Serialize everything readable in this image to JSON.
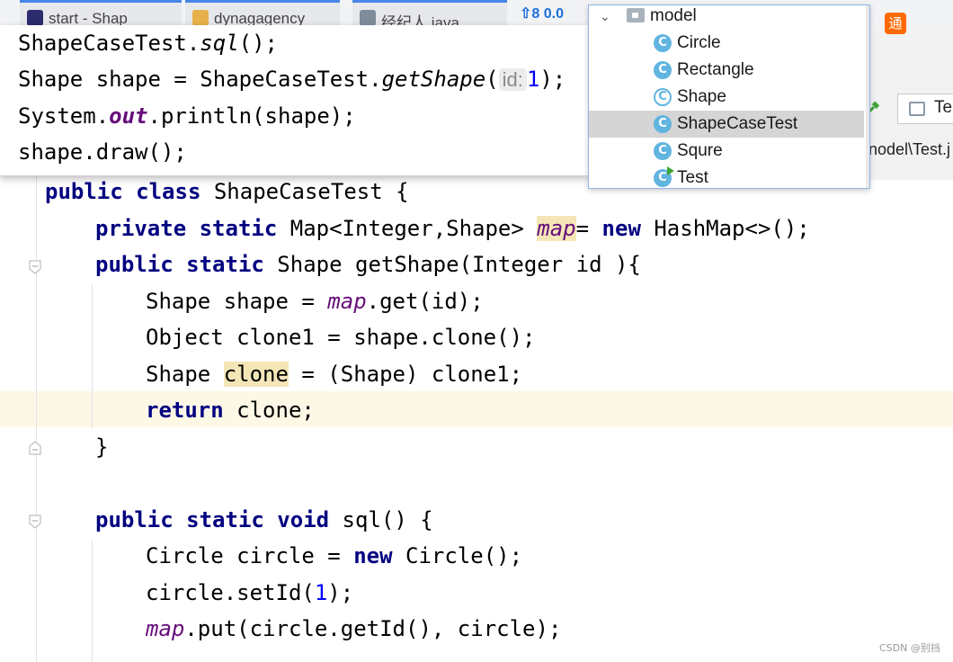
{
  "taskbar": {
    "tabs": [
      {
        "label": "start - Shap",
        "color": "#2b2b6e"
      },
      {
        "label": "dynagagency",
        "color": "#e8b04a"
      },
      {
        "label": "经纪人.java",
        "color": "#7f8c99"
      }
    ],
    "network": "⇧8 0.0"
  },
  "tray": {
    "icon": "orange-app-icon",
    "glyph": "通"
  },
  "ide": {
    "run_tab_label": "Te",
    "path_fragment": "nodel\\Test.j"
  },
  "usage_popup": {
    "lines": [
      {
        "a": "ShapeCaseTest.",
        "b": "sql",
        "c": "();"
      },
      {
        "a": "Shape shape = ShapeCaseTest.",
        "b": "getShape",
        "c": "(",
        "hint": "id:",
        "num": "1",
        "d": ");"
      },
      {
        "a": "System.",
        "b": "out",
        "c": ".println(shape);"
      },
      {
        "a": "shape.draw();"
      }
    ]
  },
  "project_tree": {
    "package": "model",
    "items": [
      {
        "label": "Circle",
        "kind": "class"
      },
      {
        "label": "Rectangle",
        "kind": "class"
      },
      {
        "label": "Shape",
        "kind": "abstract-class"
      },
      {
        "label": "ShapeCaseTest",
        "kind": "class",
        "selected": true
      },
      {
        "label": "Squre",
        "kind": "class"
      },
      {
        "label": "Test",
        "kind": "runnable-class"
      }
    ],
    "class_icon_glyph": "C"
  },
  "editor": {
    "class_decl": {
      "kw": "public class",
      "rest": " ShapeCaseTest {"
    },
    "field": {
      "kw": "private static",
      "type": " Map<Integer,Shape> ",
      "name": "map",
      "eq": "= ",
      "kw2": "new",
      "rest": " HashMap<>();"
    },
    "getshape_sig": {
      "kw": "public static",
      "rest": " Shape getShape(Integer id ){"
    },
    "l_get": {
      "a": "Shape shape = ",
      "f": "map",
      "b": ".get(id);"
    },
    "l_clone1": {
      "a": "Object clone1 = shape.clone();"
    },
    "l_cast": {
      "a": "Shape ",
      "hl": "clone",
      "b": " = (Shape) clone1;"
    },
    "l_return": {
      "kw": "return",
      "rest": " clone;"
    },
    "l_close": "}",
    "sql_sig": {
      "kw": "public static void",
      "rest": " sql() {"
    },
    "l_new": {
      "a": "Circle circle = ",
      "kw": "new",
      "b": " Circle();"
    },
    "l_setid": {
      "a": "circle.setId(",
      "num": "1",
      "b": ");"
    },
    "l_put": {
      "f": "map",
      "b": ".put(circle.getId(), circle);"
    }
  },
  "watermark": "CSDN @别挡"
}
